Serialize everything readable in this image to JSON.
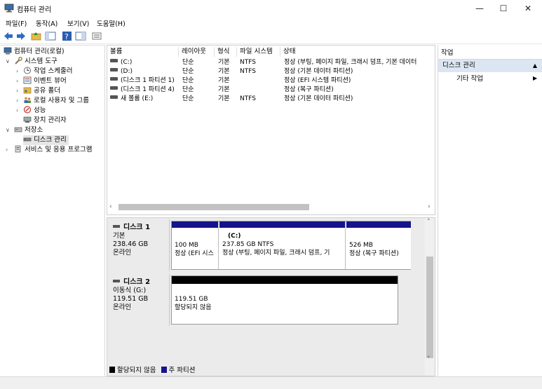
{
  "window": {
    "title": "컴퓨터 관리"
  },
  "menu": [
    "파일(F)",
    "동작(A)",
    "보기(V)",
    "도움말(H)"
  ],
  "tree": {
    "root": "컴퓨터 관리(로컬)",
    "system_tools": "시스템 도구",
    "task_scheduler": "작업 스케줄러",
    "event_viewer": "이벤트 뷰어",
    "shared_folders": "공유 폴더",
    "local_users": "로컬 사용자 및 그룹",
    "performance": "성능",
    "device_manager": "장치 관리자",
    "storage": "저장소",
    "disk_management": "디스크 관리",
    "services": "서비스 및 응용 프로그램"
  },
  "volume_table": {
    "columns": [
      "볼륨",
      "레이아웃",
      "형식",
      "파일 시스템",
      "상태"
    ],
    "rows": [
      {
        "volume": "(C:)",
        "layout": "단순",
        "type": "기본",
        "fs": "NTFS",
        "status": "정상 (부팅, 페이지 파일, 크래시 덤프, 기본 데이터"
      },
      {
        "volume": "(D:)",
        "layout": "단순",
        "type": "기본",
        "fs": "NTFS",
        "status": "정상 (기본 데이터 파티션)"
      },
      {
        "volume": "(디스크 1 파티션 1)",
        "layout": "단순",
        "type": "기본",
        "fs": "",
        "status": "정상 (EFI 시스템 파티션)"
      },
      {
        "volume": "(디스크 1 파티션 4)",
        "layout": "단순",
        "type": "기본",
        "fs": "",
        "status": "정상 (복구 파티션)"
      },
      {
        "volume": "새 볼륨 (E:)",
        "layout": "단순",
        "type": "기본",
        "fs": "NTFS",
        "status": "정상 (기본 데이터 파티션)"
      }
    ]
  },
  "disks": [
    {
      "name": "디스크 1",
      "kind": "기본",
      "size": "238.46 GB",
      "state": "온라인",
      "partitions": [
        {
          "label": "",
          "size": "100 MB",
          "status": "정상 (EFI 시스"
        },
        {
          "label": "(C:)",
          "size": "237.85 GB NTFS",
          "status": "정상 (부팅, 페이지 파일, 크래시 덤프, 기"
        },
        {
          "label": "",
          "size": "526 MB",
          "status": "정상 (복구 파티션)"
        }
      ]
    },
    {
      "name": "디스크 2",
      "kind": "이동식 (G:)",
      "size": "119.51 GB",
      "state": "온라인",
      "partitions": [
        {
          "label": "",
          "size": "119.51 GB",
          "status": "할당되지 않음"
        }
      ]
    }
  ],
  "legend": {
    "unallocated": "할당되지 않음",
    "primary": "주 파티션"
  },
  "actions": {
    "title": "작업",
    "selected": "디스크 관리",
    "more": "기타 작업"
  },
  "colors": {
    "primary_partition": "#14148c",
    "unallocated": "#000000",
    "selection": "#dce6f2"
  }
}
